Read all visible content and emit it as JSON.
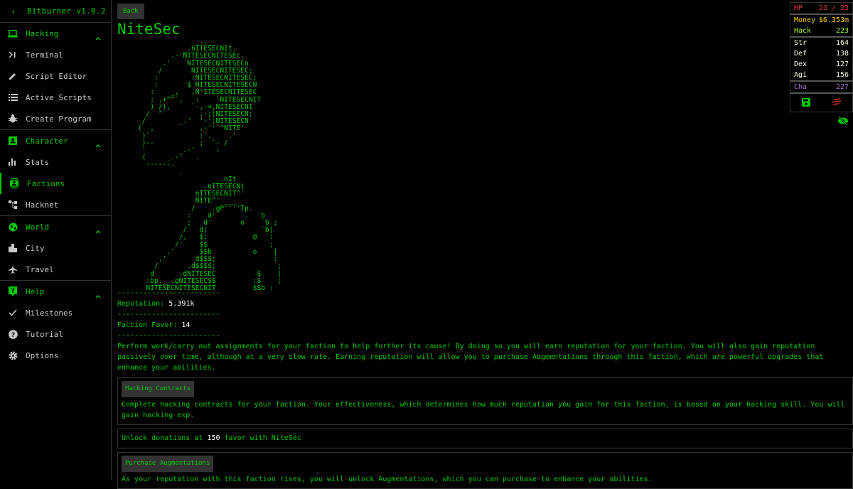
{
  "app": {
    "version_title": "Bitburner v1.0.2"
  },
  "sidebar": {
    "collapse_icon": "chevron-left-icon",
    "groups": [
      {
        "label": "Hacking",
        "icon": "laptop-icon",
        "items": [
          {
            "label": "Terminal",
            "icon": "terminal-icon"
          },
          {
            "label": "Script Editor",
            "icon": "pencil-icon"
          },
          {
            "label": "Active Scripts",
            "icon": "list-icon"
          },
          {
            "label": "Create Program",
            "icon": "bug-icon"
          }
        ]
      },
      {
        "label": "Character",
        "icon": "contact-card-icon",
        "items": [
          {
            "label": "Stats",
            "icon": "bar-chart-icon"
          },
          {
            "label": "Factions",
            "icon": "contacts-icon",
            "active": true
          },
          {
            "label": "Hacknet",
            "icon": "network-icon"
          }
        ]
      },
      {
        "label": "World",
        "icon": "globe-icon",
        "items": [
          {
            "label": "City",
            "icon": "city-icon"
          },
          {
            "label": "Travel",
            "icon": "airplane-icon"
          }
        ]
      },
      {
        "label": "Help",
        "icon": "help-bubble-icon",
        "items": [
          {
            "label": "Milestones",
            "icon": "check-icon"
          },
          {
            "label": "Tutorial",
            "icon": "question-circle-icon"
          },
          {
            "label": "Options",
            "icon": "gear-icon"
          }
        ]
      }
    ]
  },
  "main": {
    "back_label": "Back",
    "faction_name": "NiteSec",
    "ascii_art": "                  __..__\n                _.nITESECNIt.\n             .-'NITESECNITESEc.\n           .'    NITESECNITESECn\n          /       NITESECNITESEC;\n         :        :NITESECNITESEC;\n         :       $ NITESECNITESECN\n        :    _,   ,N'ITESECNITESEC\n        : .+^^`,   :    `NITESECNIT\n        ) /),     `-,-=,NITESECNI\n       /  ^         ,-;|NITESECN;\n      /        _.'  '-';NITESECN\n     (  ,           ,-''`^NITE'\n      )`            :`.    .'\n      )--           ;  `- /\n      '        _.-'     :\n      (     _.-'   .\n       ------.\n               .\n                        _.nIt\n                    _.nITESECNi\n                   nITESECNIT^'\n                   NITE^' ___\n                  /    .gP''''Tp.\n                 :    d'       .  `b\n                 ;   d'       o    `b ;\n                /   d;             `b|\n               /,   $;           @  `:\n              /'    $$               ;\n            .'      $$b          o    |\n          .'       d$$$;              :\n         /       .d$$$$;               ;\n        d      .dNITESEC          $    |\n       :bp.__.gNITESEC$$         :$    ;\n       NITESECNITESECNIT         $$b :",
    "divider": "------------------------",
    "reputation_label": "Reputation:",
    "reputation_value": "5.391k",
    "favor_label": "Faction Favor:",
    "favor_value": "14",
    "description": "Perform work/carry out assignments for your faction to help further its cause! By doing so you will earn reputation for your faction. You will also gain reputation passively over time, although at a very slow rate. Earning reputation will allow you to purchase Augmentations through this faction, which are powerful upgrades that enhance your abilities.",
    "cards": [
      {
        "button": "Hacking Contracts",
        "text": "Complete hacking contracts for your faction. Your effectiveness, which determines how much reputation you gain for this faction, is based on your hacking skill. You will gain hacking exp."
      },
      {
        "donation_prefix": "Unlock donations at",
        "donation_value": "150",
        "donation_suffix": "favor with NiteSec"
      },
      {
        "button": "Purchase Augmentations",
        "text": "As your reputation with this faction rises, you will unlock Augmentations, which you can purchase to enhance your abilities."
      }
    ]
  },
  "stats": {
    "hp": {
      "label": "HP",
      "value": "23 / 23"
    },
    "money": {
      "label": "Money",
      "value": "$6.353m"
    },
    "hack": {
      "label": "Hack",
      "value": "223"
    },
    "str": {
      "label": "Str",
      "value": "164"
    },
    "def": {
      "label": "Def",
      "value": "138"
    },
    "dex": {
      "label": "Dex",
      "value": "127"
    },
    "agi": {
      "label": "Agi",
      "value": "156"
    },
    "cha": {
      "label": "Cha",
      "value": "227"
    },
    "save_icon": "save-icon",
    "kill_icon": "kill-scripts-icon",
    "hide_icon": "visibility-off-icon"
  },
  "colors": {
    "primary": "#00cc00",
    "hp": "#dd3434",
    "money": "#ffd700",
    "hack": "#adff2f",
    "combat": "#faffdf",
    "cha": "#a671d1",
    "border": "#333333"
  }
}
